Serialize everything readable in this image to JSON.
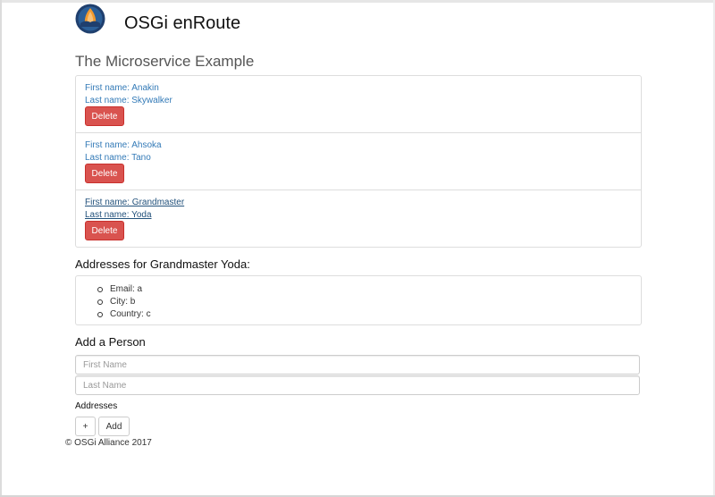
{
  "header": {
    "brand": "OSGi enRoute",
    "logo_icon": "osgi-alliance-logo"
  },
  "page": {
    "title": "The Microservice Example"
  },
  "people": [
    {
      "first_name_text": "First name: Anakin",
      "last_name_text": "Last name: Skywalker",
      "delete_label": "Delete",
      "selected": false
    },
    {
      "first_name_text": "First name: Ahsoka",
      "last_name_text": "Last name: Tano",
      "delete_label": "Delete",
      "selected": false
    },
    {
      "first_name_text": "First name: Grandmaster",
      "last_name_text": "Last name: Yoda",
      "delete_label": "Delete",
      "selected": true
    }
  ],
  "addresses": {
    "heading": "Addresses for Grandmaster Yoda:",
    "items": [
      "Email: a",
      "City: b",
      "Country: c"
    ]
  },
  "add_person": {
    "heading": "Add a Person",
    "first_name_placeholder": "First Name",
    "last_name_placeholder": "Last Name",
    "first_name_value": "",
    "last_name_value": "",
    "addresses_label": "Addresses",
    "plus_label": "+",
    "add_label": "Add"
  },
  "footer": {
    "text": "© OSGi Alliance 2017"
  },
  "colors": {
    "link": "#337ab7",
    "danger": "#d9534f",
    "border": "#dddddd"
  }
}
